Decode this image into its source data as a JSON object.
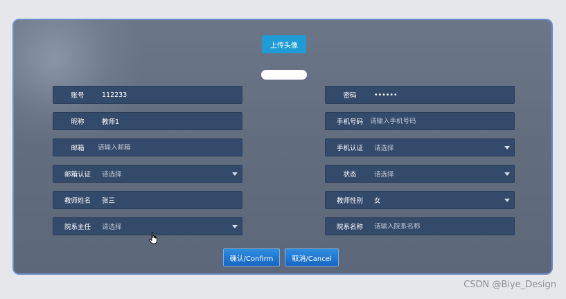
{
  "upload_button": "上传头像",
  "fields": {
    "account": {
      "label": "账号",
      "value": "112233"
    },
    "password": {
      "label": "密码",
      "value": "••••••"
    },
    "nickname": {
      "label": "昵称",
      "value": "教师1"
    },
    "phone": {
      "label": "手机号码",
      "placeholder": "请输入手机号码"
    },
    "email": {
      "label": "邮箱",
      "placeholder": "请输入邮箱"
    },
    "phone_verify": {
      "label": "手机认证",
      "value": "请选择"
    },
    "email_verify": {
      "label": "邮箱认证",
      "value": "请选择"
    },
    "status": {
      "label": "状态",
      "value": "请选择"
    },
    "teacher_name": {
      "label": "教师姓名",
      "value": "张三"
    },
    "teacher_gender": {
      "label": "教师性别",
      "value": "女"
    },
    "dept_head": {
      "label": "院系主任",
      "value": "请选择"
    },
    "dept_name": {
      "label": "院系名称",
      "placeholder": "请输入院系名称"
    }
  },
  "buttons": {
    "confirm": "确认/Confirm",
    "cancel": "取消/Cancel"
  },
  "watermark": "CSDN @Biye_Design",
  "colors": {
    "panel": "#616d7f",
    "field": "#344a6b",
    "upload": "#1f9bd6",
    "action": "#1666c4"
  }
}
